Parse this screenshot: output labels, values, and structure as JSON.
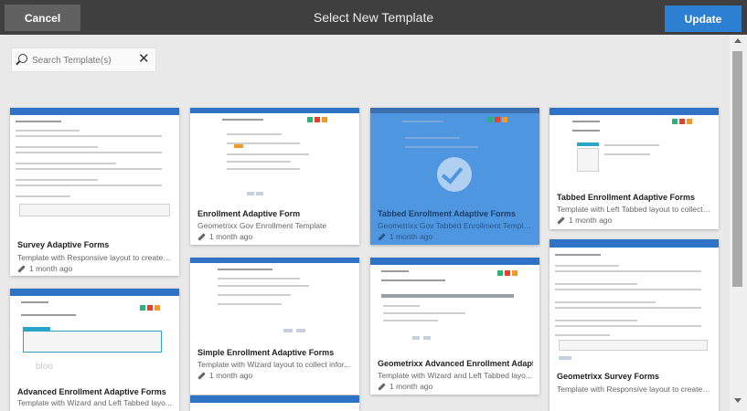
{
  "header": {
    "cancel_label": "Cancel",
    "title": "Select New Template",
    "update_label": "Update"
  },
  "search": {
    "placeholder": "Search Template(s)",
    "value": ""
  },
  "colors": {
    "accent": "#2d7fd2",
    "selected_card": "#4e97e0",
    "header_bg": "#3f3f3f"
  },
  "cards": [
    {
      "title": "Survey Adaptive Forms",
      "desc": "Template with Responsive layout to create a ...",
      "time": "1 month ago",
      "selected": false
    },
    {
      "title": "Enrollment Adaptive Form",
      "desc": "Geometrixx Gov Enrollment Template",
      "time": "1 month ago",
      "selected": false
    },
    {
      "title": "Tabbed Enrollment Adaptive Forms",
      "desc": "Geometrixx Gov Tabbed Enrollment Template",
      "time": "1 month ago",
      "selected": true
    },
    {
      "title": "Tabbed Enrollment Adaptive Forms",
      "desc": "Template with Left Tabbed layout to collect i...",
      "time": "1 month ago",
      "selected": false
    },
    {
      "title": "Simple Enrollment Adaptive Forms",
      "desc": "Template with Wizard layout to collect infor...",
      "time": "1 month ago",
      "selected": false
    },
    {
      "title": "Geometrixx Advanced Enrollment Adaptiv...",
      "desc": "Template with Wizard and Left Tabbed layo...",
      "time": "1 month ago",
      "selected": false
    },
    {
      "title": "Advanced Enrollment Adaptive Forms",
      "desc": "Template with Wizard and Left Tabbed layo...",
      "time": "",
      "selected": false
    },
    {
      "title": "Geometrixx Survey Forms",
      "desc": "Template with Responsive layout to create a ...",
      "time": "",
      "selected": false
    }
  ]
}
